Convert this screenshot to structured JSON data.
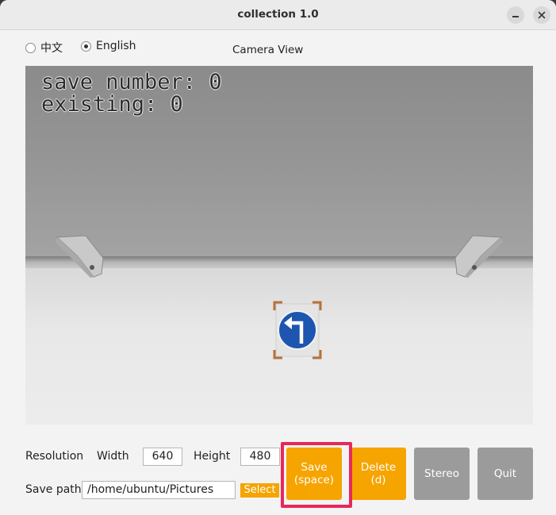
{
  "window": {
    "title": "collection 1.0"
  },
  "language": {
    "options": [
      "中文",
      "English"
    ],
    "selected": "English"
  },
  "camera": {
    "title": "Camera View",
    "overlay_save": "save number: 0",
    "overlay_existing": "existing: 0"
  },
  "controls": {
    "resolution_label": "Resolution",
    "width_label": "Width",
    "width_value": "640",
    "height_label": "Height",
    "height_value": "480",
    "save_path_label": "Save path",
    "save_path_value": "/home/ubuntu/Pictures",
    "select_label": "Select"
  },
  "buttons": {
    "save_line1": "Save",
    "save_line2": "(space)",
    "delete_line1": "Delete",
    "delete_line2": "(d)",
    "stereo": "Stereo",
    "quit": "Quit"
  },
  "colors": {
    "accent": "#f5a400",
    "disabled": "#9b9b9b",
    "highlight": "#e8285a"
  }
}
